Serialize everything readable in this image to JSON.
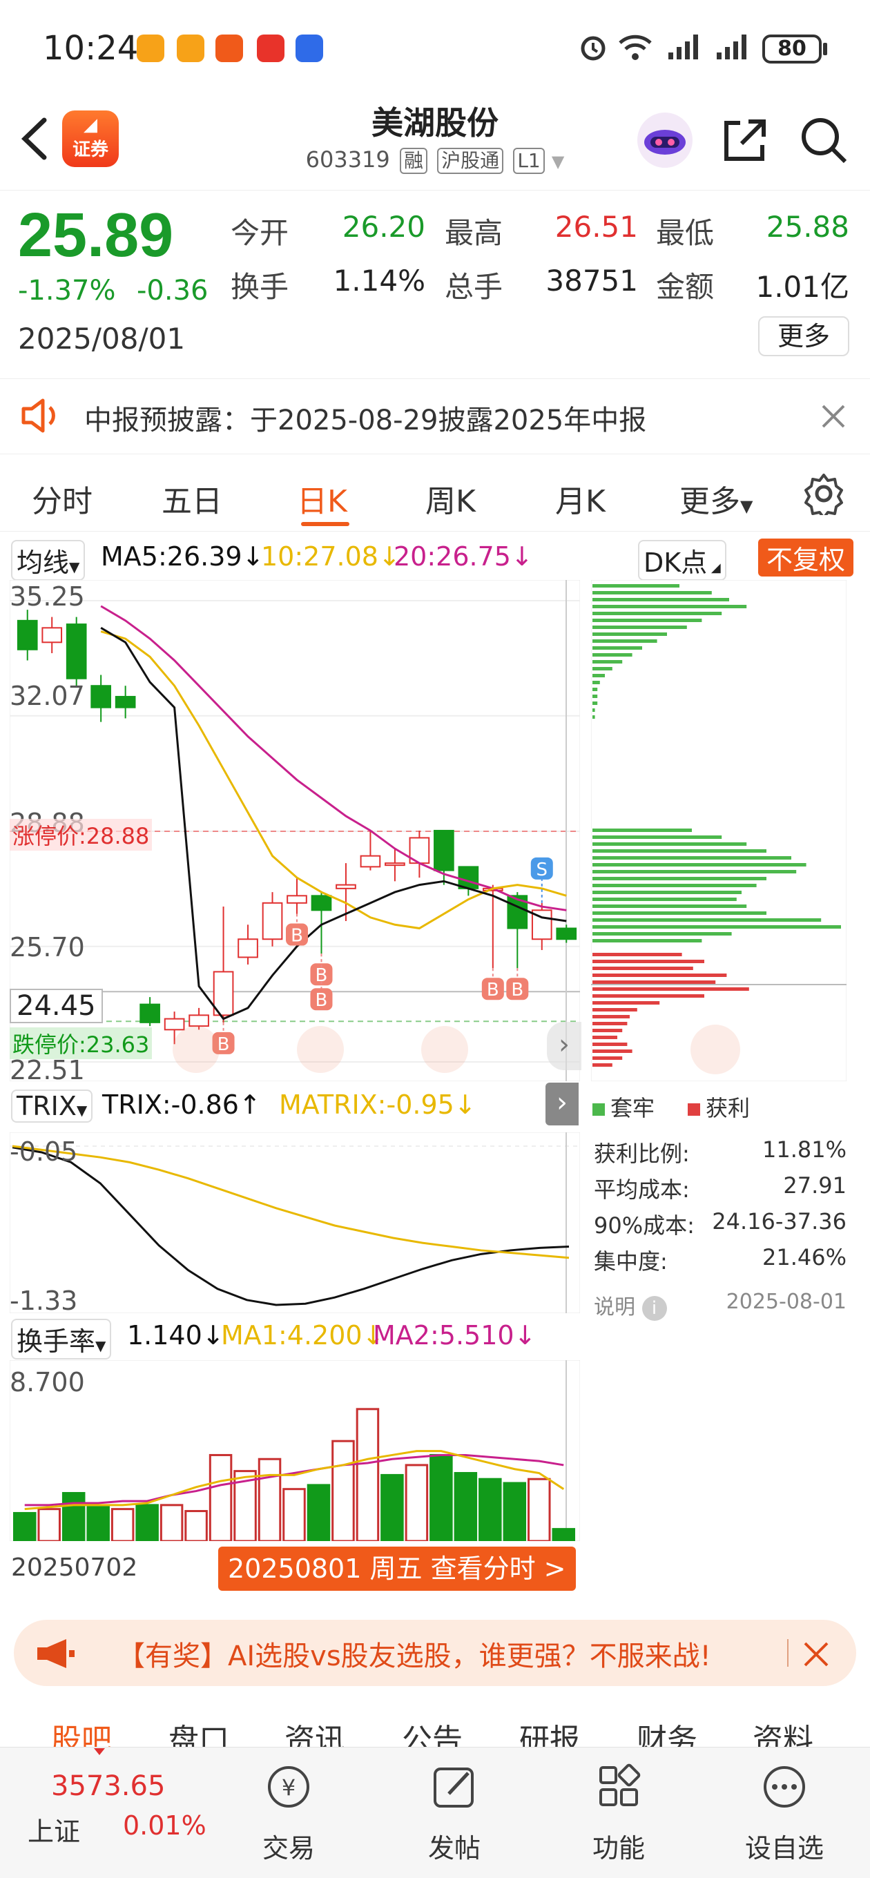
{
  "status_bar": {
    "time": "10:24",
    "battery": "80"
  },
  "header": {
    "title": "美湖股份",
    "code": "603319",
    "tags": [
      "融",
      "沪股通",
      "L1"
    ],
    "logo_text": "证券"
  },
  "quote": {
    "price": "25.89",
    "change_pct": "-1.37%",
    "change": "-0.36",
    "date": "2025/08/01",
    "stats": [
      {
        "label": "今开",
        "value": "26.20",
        "color": "#1a9a2a"
      },
      {
        "label": "最高",
        "value": "26.51",
        "color": "#e03030"
      },
      {
        "label": "最低",
        "value": "25.88",
        "color": "#1a9a2a"
      },
      {
        "label": "换手",
        "value": "1.14%",
        "color": "#222222"
      },
      {
        "label": "总手",
        "value": "38751",
        "color": "#222222"
      },
      {
        "label": "金额",
        "value": "1.01亿",
        "color": "#222222"
      }
    ],
    "more_label": "更多"
  },
  "notice": {
    "text": "中报预披露：于2025-08-29披露2025年中报"
  },
  "tabs": [
    {
      "label": "分时",
      "active": false
    },
    {
      "label": "五日",
      "active": false
    },
    {
      "label": "日K",
      "active": true
    },
    {
      "label": "周K",
      "active": false
    },
    {
      "label": "月K",
      "active": false
    },
    {
      "label": "更多",
      "active": false
    }
  ],
  "ma_row": {
    "dropdown": "均线",
    "ma5": "MA5:26.39↓",
    "ma10": "10:27.08↓",
    "ma20": "20:26.75↓",
    "dk": "DK点",
    "adjust": "不复权"
  },
  "chart_data": [
    {
      "type": "candlestick",
      "title": "日K",
      "y_ticks": [
        "35.25",
        "32.07",
        "28.88",
        "25.70",
        "22.51"
      ],
      "ylim": [
        22.51,
        35.25
      ],
      "limit_up_label": "涨停价:28.88",
      "limit_down_label": "跌停价:23.63",
      "crosshair_label": "24.45",
      "candles": [
        {
          "o": 34.7,
          "c": 33.9,
          "h": 35.0,
          "l": 33.6
        },
        {
          "o": 34.1,
          "c": 34.5,
          "h": 34.8,
          "l": 33.8
        },
        {
          "o": 34.6,
          "c": 33.1,
          "h": 34.8,
          "l": 32.9
        },
        {
          "o": 32.9,
          "c": 32.3,
          "h": 33.2,
          "l": 31.9
        },
        {
          "o": 32.6,
          "c": 32.3,
          "h": 32.9,
          "l": 32.0
        },
        {
          "o": 24.1,
          "c": 23.6,
          "h": 24.3,
          "l": 23.5
        },
        {
          "o": 23.4,
          "c": 23.7,
          "h": 23.9,
          "l": 23.0
        },
        {
          "o": 23.5,
          "c": 23.8,
          "h": 24.0,
          "l": 23.4
        },
        {
          "o": 23.8,
          "c": 25.0,
          "h": 26.8,
          "l": 23.6
        },
        {
          "o": 25.4,
          "c": 25.9,
          "h": 26.3,
          "l": 25.2
        },
        {
          "o": 25.9,
          "c": 26.9,
          "h": 27.2,
          "l": 25.7
        },
        {
          "o": 26.9,
          "c": 27.1,
          "h": 27.6,
          "l": 26.6
        },
        {
          "o": 27.1,
          "c": 26.7,
          "h": 27.2,
          "l": 25.5
        },
        {
          "o": 27.3,
          "c": 27.4,
          "h": 28.0,
          "l": 26.4
        },
        {
          "o": 27.9,
          "c": 28.2,
          "h": 28.9,
          "l": 27.8
        },
        {
          "o": 28.0,
          "c": 28.0,
          "h": 28.4,
          "l": 27.5
        },
        {
          "o": 28.0,
          "c": 28.7,
          "h": 28.9,
          "l": 27.6
        },
        {
          "o": 28.9,
          "c": 27.8,
          "h": 28.9,
          "l": 27.4
        },
        {
          "o": 27.9,
          "c": 27.3,
          "h": 27.9,
          "l": 27.1
        },
        {
          "o": 27.3,
          "c": 27.3,
          "h": 27.4,
          "l": 25.1
        },
        {
          "o": 27.1,
          "c": 26.2,
          "h": 27.2,
          "l": 25.1
        },
        {
          "o": 25.9,
          "c": 26.7,
          "h": 26.9,
          "l": 25.6
        },
        {
          "o": 26.2,
          "c": 25.9,
          "h": 26.3,
          "l": 25.8
        }
      ],
      "ma5": [
        34.5,
        34.1,
        33.0,
        32.3,
        24.6,
        23.7,
        24.0,
        24.9,
        25.7,
        26.3,
        26.6,
        26.9,
        27.2,
        27.4,
        27.5,
        27.3,
        27.1,
        26.8,
        26.5,
        26.4
      ],
      "ma10": [
        34.4,
        34.2,
        33.7,
        32.9,
        31.8,
        30.6,
        29.4,
        28.2,
        27.6,
        27.2,
        26.9,
        26.5,
        26.3,
        26.2,
        26.6,
        27.0,
        27.3,
        27.4,
        27.3,
        27.1
      ],
      "ma20": [
        35.1,
        34.7,
        34.2,
        33.6,
        32.9,
        32.2,
        31.5,
        30.9,
        30.3,
        29.8,
        29.3,
        28.9,
        28.4,
        28.0,
        27.7,
        27.5,
        27.3,
        27.0,
        26.8,
        26.7
      ],
      "markers": [
        {
          "i": 8,
          "label": "B"
        },
        {
          "i": 11,
          "label": "B"
        },
        {
          "i": 12,
          "label": "B"
        },
        {
          "i": 12,
          "label": "B"
        },
        {
          "i": 19,
          "label": "B"
        },
        {
          "i": 20,
          "label": "B"
        },
        {
          "i": 21,
          "label": "S"
        }
      ],
      "date_start": "20250702",
      "date_tooltip": "20250801 周五 查看分时 >"
    },
    {
      "type": "line",
      "title": "TRIX",
      "series": [
        {
          "name": "TRIX",
          "values": [
            -0.06,
            -0.1,
            -0.18,
            -0.35,
            -0.6,
            -0.85,
            -1.05,
            -1.2,
            -1.29,
            -1.33,
            -1.32,
            -1.27,
            -1.2,
            -1.12,
            -1.04,
            -0.97,
            -0.92,
            -0.89,
            -0.87,
            -0.86
          ],
          "color": "#111111"
        },
        {
          "name": "MATRIX",
          "values": [
            -0.05,
            -0.08,
            -0.11,
            -0.14,
            -0.18,
            -0.24,
            -0.31,
            -0.39,
            -0.47,
            -0.55,
            -0.62,
            -0.69,
            -0.74,
            -0.79,
            -0.83,
            -0.86,
            -0.89,
            -0.91,
            -0.93,
            -0.95
          ],
          "color": "#e8b800"
        }
      ],
      "y_ticks": [
        "-0.05",
        "-1.33"
      ],
      "ylim": [
        -1.33,
        -0.05
      ],
      "dropdown": "TRIX",
      "trix_label": "TRIX:-0.86↑",
      "matrix_label": "MATRIX:-0.95↓"
    },
    {
      "type": "bar",
      "title": "换手率",
      "values": [
        1.4,
        1.6,
        2.4,
        1.7,
        1.6,
        1.8,
        1.8,
        1.5,
        4.3,
        3.5,
        4.1,
        2.6,
        2.8,
        5.0,
        6.6,
        3.3,
        3.8,
        4.3,
        3.4,
        3.1,
        2.9,
        3.1,
        0.6
      ],
      "up": [
        false,
        true,
        false,
        false,
        true,
        false,
        true,
        true,
        true,
        true,
        true,
        true,
        false,
        true,
        true,
        false,
        true,
        false,
        false,
        false,
        false,
        true,
        false
      ],
      "ma1": [
        1.6,
        1.7,
        1.8,
        1.8,
        1.8,
        1.9,
        2.3,
        2.7,
        3.0,
        3.2,
        3.3,
        3.3,
        3.6,
        3.8,
        4.1,
        4.3,
        4.5,
        4.5,
        4.2,
        3.9,
        3.6,
        3.4,
        2.6
      ],
      "ma2": [
        1.8,
        1.8,
        1.9,
        1.9,
        2.0,
        2.0,
        2.3,
        2.5,
        2.8,
        3.0,
        3.2,
        3.4,
        3.6,
        3.8,
        3.9,
        4.1,
        4.2,
        4.3,
        4.3,
        4.2,
        4.1,
        4.0,
        3.8
      ],
      "y_ticks": [
        "8.700"
      ],
      "ylim": [
        0,
        8.7
      ],
      "dropdown": "换手率",
      "value_label": "1.140↓",
      "ma1_label": "MA1:4.200↓",
      "ma2_label": "MA2:5.510↓"
    },
    {
      "type": "bar",
      "title": "筹码分布",
      "profit_bars": [
        0.4,
        0.5,
        0.45,
        0.6,
        0.55,
        0.7,
        0.5,
        0.3,
        0.2,
        0.15,
        0.1
      ],
      "trapped_bars_top": [
        0.35,
        0.48,
        0.55,
        0.62,
        0.52,
        0.44,
        0.38,
        0.3,
        0.26,
        0.2,
        0.16,
        0.12,
        0.08,
        0.05,
        0.03,
        0.02,
        0.02,
        0.02,
        0.01,
        0.01
      ],
      "trapped_bars_mid": [
        0.4,
        0.52,
        0.62,
        0.7,
        0.8,
        0.86,
        0.82,
        0.7,
        0.66,
        0.6,
        0.58,
        0.62,
        0.7,
        0.92,
        1.0,
        0.56,
        0.44
      ],
      "legend_trapped": "套牢",
      "legend_profit": "获利"
    }
  ],
  "chip_stats": [
    {
      "label": "获利比例:",
      "value": "11.81%"
    },
    {
      "label": "平均成本:",
      "value": "27.91"
    },
    {
      "label": "90%成本:",
      "value": "24.16-37.36"
    },
    {
      "label": "集中度:",
      "value": "21.46%"
    }
  ],
  "chip_note": {
    "label": "说明",
    "date": "2025-08-01"
  },
  "promo": {
    "text": "【有奖】AI选股vs股友选股，谁更强？不服来战!"
  },
  "subtabs": [
    "股吧",
    "盘口",
    "资讯",
    "公告",
    "研报",
    "财务",
    "资料"
  ],
  "bottom_bar": {
    "index_value": "3573.65",
    "index_name": "上证",
    "index_change": "0.01%",
    "items": [
      "交易",
      "发帖",
      "功能",
      "设自选"
    ]
  },
  "colors": {
    "up": "#e03030",
    "down": "#119a1a",
    "accent": "#f05a1a",
    "ma5": "#111111",
    "ma10": "#e8b800",
    "ma20": "#c8208c"
  }
}
